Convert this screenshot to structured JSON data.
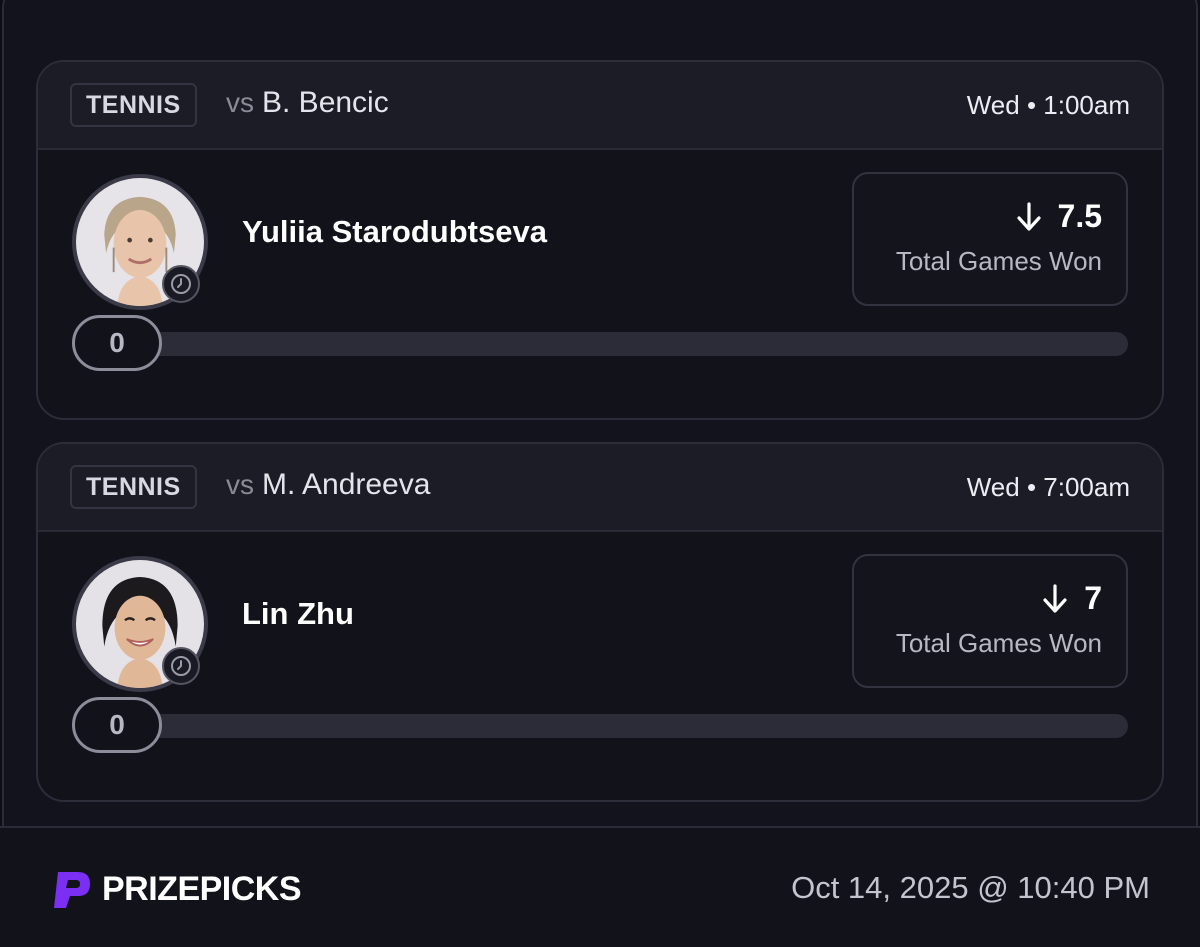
{
  "cards": [
    {
      "sport": "TENNIS",
      "vs_word": "vs",
      "opponent": "B. Bencic",
      "time": "Wed • 1:00am",
      "player": "Yuliia Starodubtseva",
      "line_value": "7.5",
      "stat": "Total Games Won",
      "direction_icon": "arrow-down-icon",
      "progress_value": "0",
      "progress_fraction": 0
    },
    {
      "sport": "TENNIS",
      "vs_word": "vs",
      "opponent": "M. Andreeva",
      "time": "Wed • 7:00am",
      "player": "Lin Zhu",
      "line_value": "7",
      "stat": "Total Games Won",
      "direction_icon": "arrow-down-icon",
      "progress_value": "0",
      "progress_fraction": 0
    }
  ],
  "footer": {
    "brand": "PRIZEPICKS",
    "timestamp": "Oct 14, 2025 @ 10:40 PM"
  },
  "colors": {
    "background": "#13131d",
    "card_header": "#1c1c26",
    "brand_purple": "#7a2ff2",
    "track": "#2c2c38"
  }
}
